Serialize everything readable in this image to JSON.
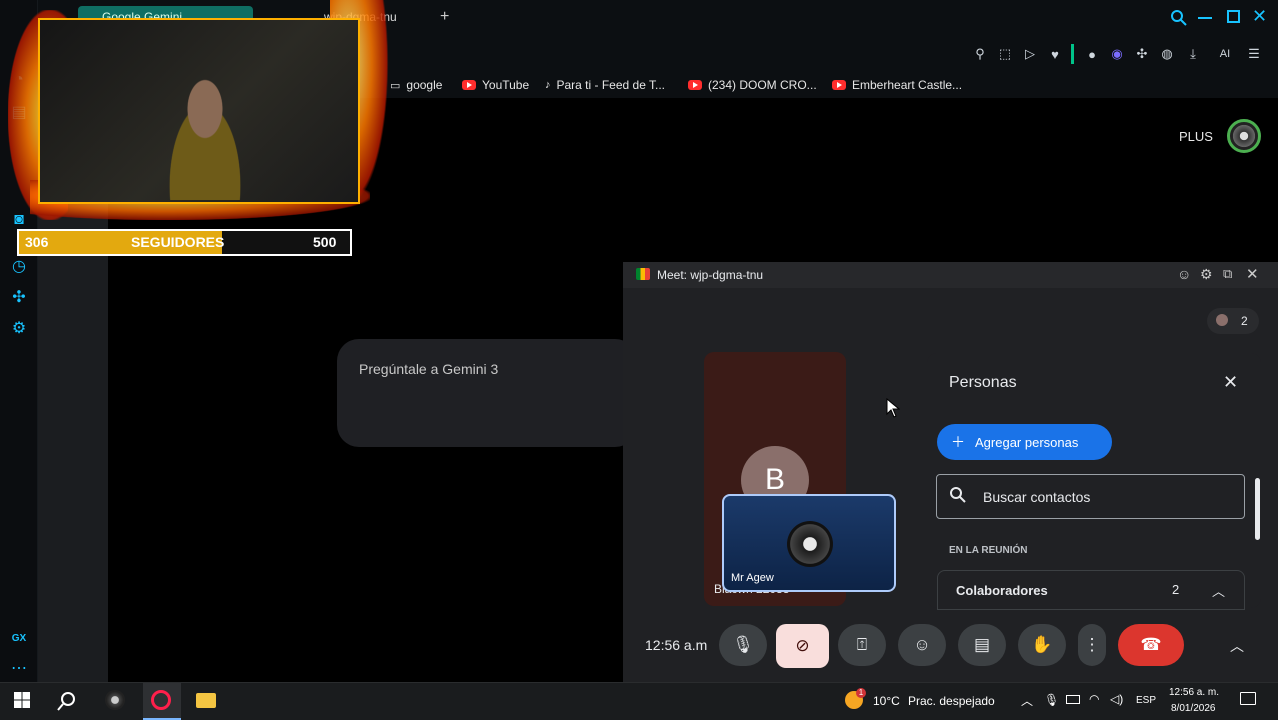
{
  "browser": {
    "tabs": [
      {
        "label": "Google Gemini"
      },
      {
        "label": "wjp-dgma-tnu"
      }
    ],
    "new_tab": "+",
    "toolbar_ai": "AI",
    "plus_label": "PLUS",
    "bookmarks": [
      {
        "label": "google",
        "icon": "folder-icon"
      },
      {
        "label": "YouTube",
        "icon": "youtube-icon"
      },
      {
        "label": "Para ti - Feed de T...",
        "icon": "tiktok-icon"
      },
      {
        "label": "(234) DOOM CRO...",
        "icon": "youtube-icon"
      },
      {
        "label": "Emberheart Castle...",
        "icon": "youtube-icon"
      }
    ],
    "sidebar_bottom": "GX"
  },
  "gemini": {
    "prompt_placeholder": "Pregúntale a Gemini 3"
  },
  "overlay": {
    "followers_current": "306",
    "followers_label": "SEGUIDORES",
    "followers_goal": "500",
    "progress_fraction": 0.612
  },
  "meet": {
    "window_title": "Meet: wjp-dgma-tnu",
    "participant_count": "2",
    "tile_b": {
      "initial": "B",
      "name": "Blacwn 22033"
    },
    "self_tile_name": "Mr Agew",
    "people_panel": {
      "title": "Personas",
      "add_button": "Agregar personas",
      "search_placeholder": "Buscar contactos",
      "section_label": "EN LA REUNIÓN",
      "group_name": "Colaboradores",
      "group_count": "2"
    },
    "time": "12:56 a.m"
  },
  "taskbar": {
    "weather_temp": "10°C",
    "weather_text": "Prac. despejado",
    "lang": "ESP",
    "clock_time": "12:56 a. m.",
    "clock_date": "8/01/2026",
    "notification_badge": "1"
  }
}
